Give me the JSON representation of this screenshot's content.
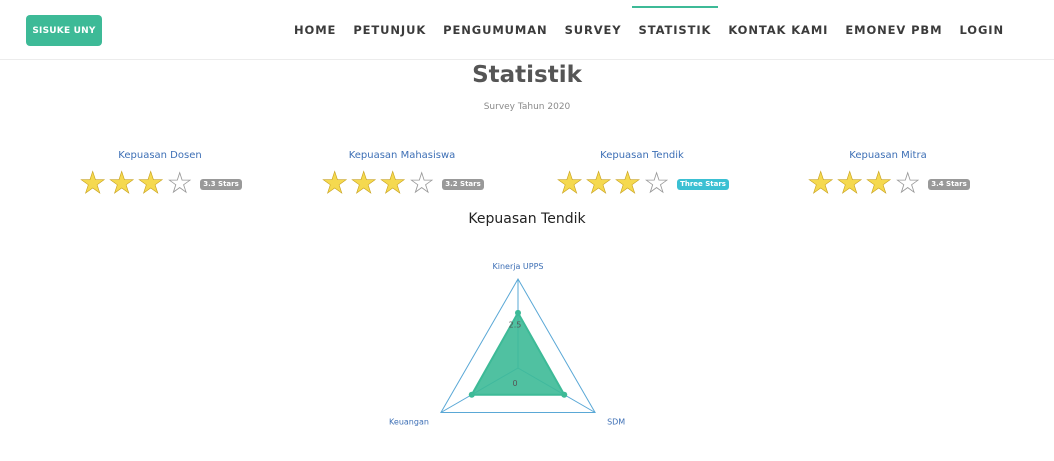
{
  "navbar": {
    "brand": "SISUKE UNY",
    "items": [
      {
        "label": "HOME",
        "active": false
      },
      {
        "label": "PETUNJUK",
        "active": false
      },
      {
        "label": "PENGUMUMAN",
        "active": false
      },
      {
        "label": "SURVEY",
        "active": false
      },
      {
        "label": "STATISTIK",
        "active": true
      },
      {
        "label": "KONTAK KAMI",
        "active": false
      },
      {
        "label": "EMONEV PBM",
        "active": false
      },
      {
        "label": "LOGIN",
        "active": false
      }
    ]
  },
  "page": {
    "title": "Statistik",
    "subtitle": "Survey Tahun 2020"
  },
  "ratings": [
    {
      "title": "Kepuasan Dosen",
      "stars_filled": 3,
      "stars_total": 4,
      "badge": "3.3 Stars",
      "badge_style": "default"
    },
    {
      "title": "Kepuasan Mahasiswa",
      "stars_filled": 3,
      "stars_total": 4,
      "badge": "3.2 Stars",
      "badge_style": "default"
    },
    {
      "title": "Kepuasan Tendik",
      "stars_filled": 3,
      "stars_total": 4,
      "badge": "Three Stars",
      "badge_style": "info"
    },
    {
      "title": "Kepuasan Mitra",
      "stars_filled": 3,
      "stars_total": 4,
      "badge": "3.4 Stars",
      "badge_style": "default"
    }
  ],
  "chart_title": "Kepuasan Tendik",
  "chart_data": {
    "type": "radar",
    "title": "Kepuasan Tendik",
    "categories": [
      "Kinerja UPPS",
      "SDM",
      "Keuangan"
    ],
    "tick_labels": [
      "0",
      "2.5"
    ],
    "range": [
      0,
      5
    ],
    "series": [
      {
        "values": [
          3.1,
          3.0,
          3.0
        ]
      }
    ],
    "colors": {
      "fill": "#3dba97",
      "axis": "#5aa8d6",
      "label": "#3d6fb5"
    }
  }
}
